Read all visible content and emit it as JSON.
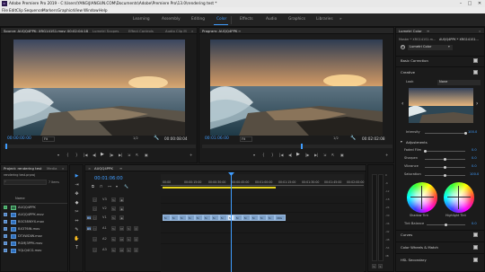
{
  "window": {
    "title": "Adobe Premiere Pro 2019 - C:\\Users\\YANG\\JIANGUN.COM\\Documents\\Adobe\\Premiere Pro\\13.0\\rendering test *",
    "app_icon": "Pr",
    "controls": {
      "minimize": "–",
      "maximize": "□",
      "close": "✕"
    }
  },
  "menu": [
    "File",
    "Edit",
    "Clip",
    "Sequence",
    "Markers",
    "Graphics",
    "View",
    "Window",
    "Help"
  ],
  "workspaces": [
    "Learning",
    "Assembly",
    "Editing",
    "Color",
    "Effects",
    "Audio",
    "Graphics",
    "Libraries"
  ],
  "workspaces_more": "»",
  "active_workspace": "Color",
  "source_monitor": {
    "tabs": [
      "Source: AUQQ4PPK: XRG141S1.mov: 00:02:04:18",
      "Lumetri Scopes",
      "Effect Controls",
      "Audio Clip M"
    ],
    "more": "»",
    "timecode_left": "00:00:00:00",
    "fit": "Fit",
    "fraction": "1/2",
    "timecode_right": "00:00:08:04"
  },
  "program_monitor": {
    "tab": "Program: AUQQ4PPK",
    "menu_icon": "≡",
    "timecode_left": "00:01:06:00",
    "fit": "Fit",
    "fraction": "1/2",
    "timecode_right": "00:02:02:08"
  },
  "transport": {
    "marker": "▾",
    "in": "{",
    "out": "}",
    "go_in": "|◀",
    "step_back": "◀|",
    "play": "▶",
    "step_fwd": "|▶",
    "go_out": "▶|",
    "insert": "⇲",
    "overwrite": "⇱",
    "export": "▣",
    "add": "+"
  },
  "lumetri": {
    "tab": "Lumetri Color",
    "menu_icon": "≡",
    "more": "»",
    "master_clip": "Master * XRG141S1.m...",
    "dropdown_clip": "AUQQ4PPK * XRG141S1...",
    "dropdown_arrow": "▾",
    "effect": "Lumetri Color",
    "sections": {
      "basic": "Basic Correction",
      "creative": "Creative",
      "adjustments": "Adjustments",
      "curves": "Curves",
      "wheels": "Color Wheels & Match",
      "hsl": "HSL Secondary"
    },
    "look_label": "Look",
    "look_value": "None",
    "look_prev": "‹",
    "look_next": "›",
    "intensity_label": "Intensity",
    "intensity_value": "100.0",
    "intensity_level": 1.0,
    "adjustments": [
      {
        "label": "Faded Film",
        "value": "0.0",
        "level": 0.0
      },
      {
        "label": "Sharpen",
        "value": "0.0",
        "level": 0.5
      },
      {
        "label": "Vibrance",
        "value": "0.0",
        "level": 0.5
      },
      {
        "label": "Saturation",
        "value": "100.0",
        "level": 0.5
      }
    ],
    "shadow_tint": "Shadow Tint",
    "highlight_tint": "Highlight Tint",
    "tint_balance": "Tint Balance",
    "tint_balance_value": "0.0",
    "tint_balance_level": 0.5
  },
  "project": {
    "tabs": [
      "Project: rendering test",
      "Media"
    ],
    "more": "»",
    "file": "rendering test.prproj",
    "items_count": "7 Items",
    "column": "Name",
    "items": [
      "AUQQ4PPK",
      "AUQQ4PPK.mov",
      "B0C58WYX.mov",
      "BX3T6IN.mov",
      "DTXWDIW.mov",
      "RGMJ3PPK.mov",
      "YQLQ4CG.mov"
    ]
  },
  "tools": [
    "▶",
    "⇥",
    "✥",
    "◆",
    "✂",
    "⇔",
    "✎",
    "✋",
    "T"
  ],
  "timeline": {
    "tab": "AUQQ4PPK",
    "close": "×",
    "menu_icon": "≡",
    "timecode": "00:01:06:00",
    "ruler": [
      "00:00",
      "00:00:15:00",
      "00:00:30:00",
      "00:00:45:00",
      "00:01:00:00",
      "00:01:15:00",
      "00:01:30:00",
      "00:01:45:00",
      "00:02:00:00"
    ],
    "video_tracks": [
      "V3",
      "V2",
      "V1"
    ],
    "audio_tracks": [
      "A1",
      "A2",
      "A3"
    ],
    "track_source": [
      "V1",
      "A1"
    ],
    "track_buttons": {
      "lock": "🔒",
      "sync": "⇆",
      "eye": "◉",
      "mute": "M",
      "solo": "S",
      "mic": "⦿"
    },
    "clip_labels": [
      "fx",
      "fx",
      "fx",
      "fx",
      "fx",
      "fx",
      "fx",
      "fx",
      "fx",
      "fx",
      "fx",
      "fx",
      "fx",
      "fx",
      "fx"
    ],
    "clip_tail": "XRG",
    "meter_labels": [
      "0",
      "-6",
      "-12",
      "-18",
      "-24",
      "-30",
      "-36",
      "-42",
      "-48",
      "-54",
      "dB"
    ],
    "meter_solo": [
      "S",
      "S"
    ]
  },
  "colors": {
    "accent_blue": "#3f9dff",
    "video_clip": "#7da0c8",
    "audio_clip": "#2f6a45",
    "work_area": "#e8d51a"
  }
}
